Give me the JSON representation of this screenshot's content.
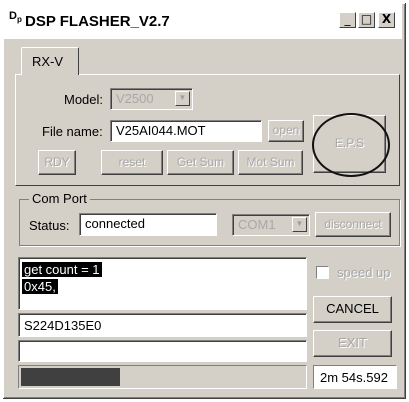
{
  "window": {
    "title": "DSP FLASHER_V2.7",
    "icon_glyph": "D",
    "minimize_glyph": "_",
    "maximize_glyph": "□",
    "close_glyph": "X"
  },
  "tab": {
    "label": "RX-V"
  },
  "rxv": {
    "model_label": "Model:",
    "model_value": "V2500",
    "filename_label": "File name:",
    "filename_value": "V25AI044.MOT",
    "open_label": "open",
    "eps_label": "E.P.S",
    "rdy_label": "RDY",
    "reset_label": "reset",
    "getsum_label": "Get Sum",
    "motsum_label": "Mot Sum"
  },
  "comport": {
    "group_title": "Com Port",
    "status_label": "Status:",
    "status_value": "connected",
    "port_value": "COM1",
    "disconnect_label": "disconnect"
  },
  "log": {
    "lines": [
      "get count = 1",
      "0x45,"
    ],
    "checksum_value": "S224D135E0",
    "empty_value": ""
  },
  "controls": {
    "speedup_label": "speed up",
    "speedup_checked": false,
    "cancel_label": "CANCEL",
    "exit_label": "EXIT"
  },
  "progress": {
    "fraction": 0.35
  },
  "timer": {
    "value": "2m 54s.592"
  }
}
